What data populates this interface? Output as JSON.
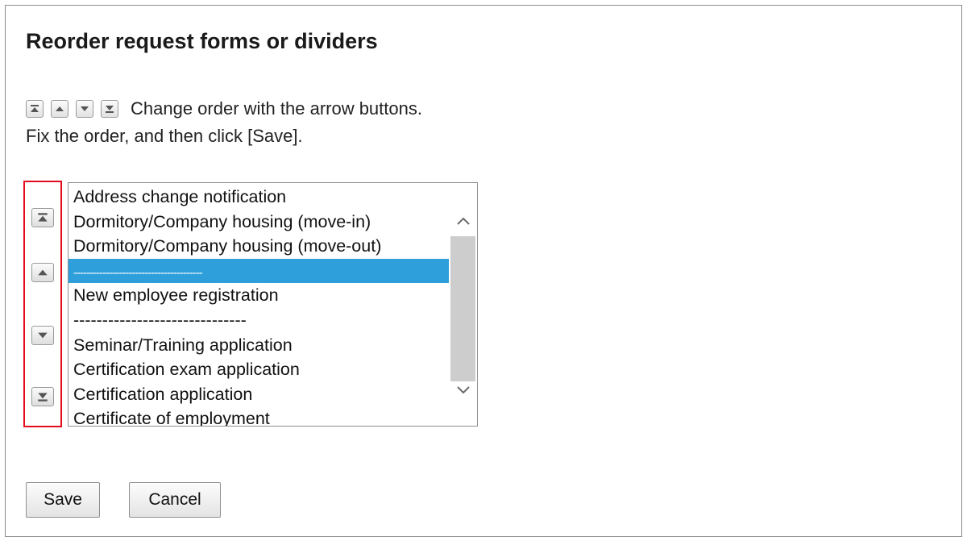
{
  "dialog": {
    "title": "Reorder request forms or dividers",
    "instruction_line1": "Change order with the arrow buttons.",
    "instruction_line2": "Fix the order, and then click [Save]."
  },
  "order_controls": {
    "top_icon": "move-to-top-icon",
    "up_icon": "move-up-icon",
    "down_icon": "move-down-icon",
    "bottom_icon": "move-to-bottom-icon",
    "highlight_color": "#e30b1c"
  },
  "listbox": {
    "items": [
      "Address change notification",
      "Dormitory/Company housing (move-in)",
      "Dormitory/Company housing (move-out)",
      "----------------------------------------",
      "New employee registration",
      "------------------------------",
      "Seminar/Training application",
      "Certification exam application",
      "Certification application",
      "Certificate of employment"
    ],
    "selected_index": 3,
    "selection_color": "#2f9fdc"
  },
  "buttons": {
    "save": "Save",
    "cancel": "Cancel"
  }
}
